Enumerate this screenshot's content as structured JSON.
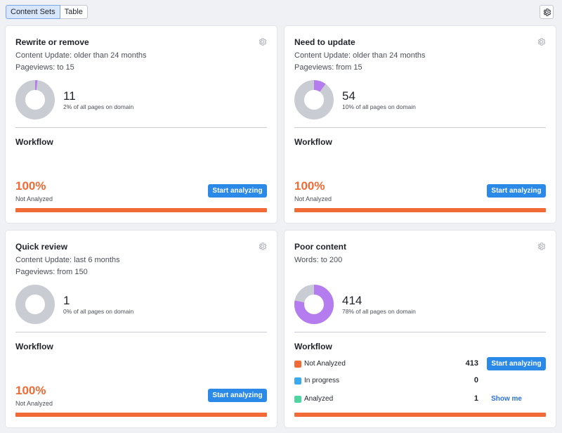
{
  "tabs": [
    {
      "label": "Content Sets",
      "active": true
    },
    {
      "label": "Table",
      "active": false
    }
  ],
  "colors": {
    "accent": "#2b8ae8",
    "not_analyzed": "#f26a35",
    "in_progress": "#3aa9ee",
    "analyzed": "#4fd6a0",
    "donut_rest": "#c9ccd3",
    "donut_share": "#b57cf0"
  },
  "cards": [
    {
      "title": "Rewrite or remove",
      "meta": [
        "Content Update: older than 24 months",
        "Pageviews: to 15"
      ],
      "count": "11",
      "share_text": "2% of all pages on domain",
      "share_fraction": 0.02,
      "workflow_title": "Workflow",
      "percent": "100%",
      "percent_label": "Not Analyzed",
      "progress": 1.0,
      "button": "Start analyzing"
    },
    {
      "title": "Need to update",
      "meta": [
        "Content Update: older than 24 months",
        "Pageviews: from 15"
      ],
      "count": "54",
      "share_text": "10% of all pages on domain",
      "share_fraction": 0.1,
      "workflow_title": "Workflow",
      "percent": "100%",
      "percent_label": "Not Analyzed",
      "progress": 1.0,
      "button": "Start analyzing"
    },
    {
      "title": "Quick review",
      "meta": [
        "Content Update: last 6 months",
        "Pageviews: from 150"
      ],
      "count": "1",
      "share_text": "0% of all pages on domain",
      "share_fraction": 0.0,
      "workflow_title": "Workflow",
      "percent": "100%",
      "percent_label": "Not Analyzed",
      "progress": 1.0,
      "button": "Start analyzing"
    },
    {
      "title": "Poor content",
      "meta": [
        "Words: to 200"
      ],
      "count": "414",
      "share_text": "78% of all pages on domain",
      "share_fraction": 0.78,
      "workflow_title": "Workflow",
      "progress": 1.0,
      "legend": [
        {
          "label": "Not Analyzed",
          "value": "413",
          "color": "#f26a35",
          "action": "Start analyzing"
        },
        {
          "label": "In progress",
          "value": "0",
          "color": "#3aa9ee"
        },
        {
          "label": "Analyzed",
          "value": "1",
          "color": "#4fd6a0",
          "action": "Show me"
        }
      ]
    }
  ]
}
